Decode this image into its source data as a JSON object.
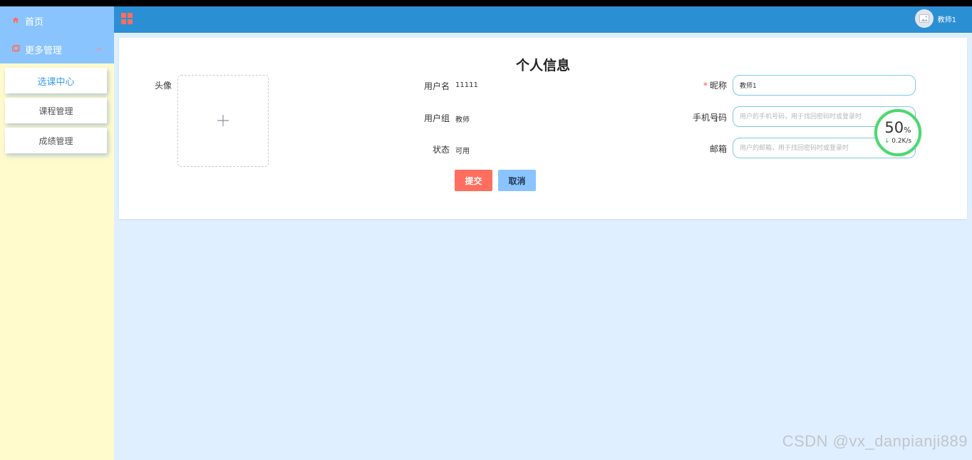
{
  "sidebar": {
    "items": [
      {
        "icon": "home-icon",
        "label": "首页"
      },
      {
        "icon": "folder-icon",
        "label": "更多管理",
        "expanded": true
      }
    ],
    "submenu": [
      {
        "label": "选课中心",
        "active": true
      },
      {
        "label": "课程管理",
        "active": false
      },
      {
        "label": "成绩管理",
        "active": false
      }
    ]
  },
  "header": {
    "user_name": "教师1"
  },
  "profile": {
    "title": "个人信息",
    "avatar_label": "头像",
    "username_label": "用户名",
    "username_value": "11111",
    "group_label": "用户组",
    "group_value": "教师",
    "status_label": "状态",
    "status_value": "可用",
    "nickname_label": "昵称",
    "nickname_value": "教师1",
    "phone_label": "手机号码",
    "phone_placeholder": "用户的手机号码，用于找回密码时或登录时",
    "email_label": "邮箱",
    "email_placeholder": "用户的邮箱，用于找回密码时或登录时",
    "submit_label": "提交",
    "cancel_label": "取消"
  },
  "speed_widget": {
    "percent": "50",
    "percent_unit": "%",
    "rate": "0.2K/s"
  },
  "watermark": "CSDN @vx_danpianji889",
  "colors": {
    "header": "#2b8fd4",
    "sidebar_bg": "#fffbcc",
    "menu_bg": "#8ac4ff",
    "accent": "#ff6e5e",
    "page_bg": "#e0efff"
  }
}
